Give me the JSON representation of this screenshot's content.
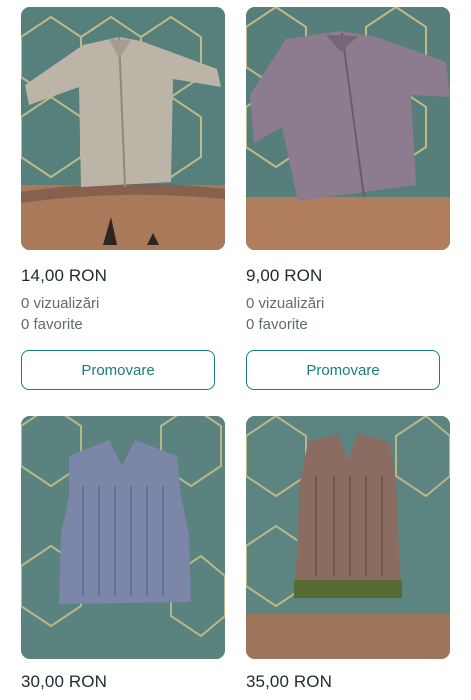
{
  "listings": [
    {
      "price": "14,00 RON",
      "views": "0 vizualizări",
      "favorites": "0 favorite",
      "action": "Promovare"
    },
    {
      "price": "9,00 RON",
      "views": "0 vizualizări",
      "favorites": "0 favorite",
      "action": "Promovare"
    },
    {
      "price": "30,00 RON"
    },
    {
      "price": "35,00 RON"
    }
  ],
  "colors": {
    "accent": "#1a7f74",
    "price_text": "#1d2b30",
    "muted_text": "#5f6c70"
  }
}
